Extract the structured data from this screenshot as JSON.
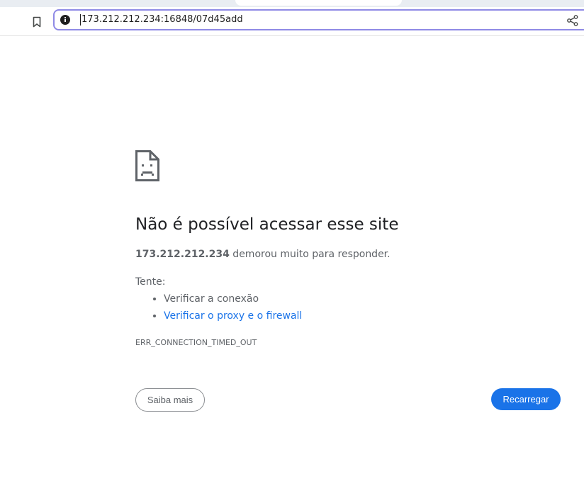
{
  "toolbar": {
    "bookmark_icon": "bookmark-icon",
    "site_info_icon": "info-icon",
    "url": "173.212.212.234:16848/07d45add",
    "share_icon": "share-icon"
  },
  "error_page": {
    "icon": "sad-page-icon",
    "title": "Não é possível acessar esse site",
    "summary_host": "173.212.212.234",
    "summary_text": " demorou muito para responder.",
    "suggestions_heading": "Tente:",
    "suggestions": [
      "Verificar a conexão",
      "Verificar o proxy e o firewall"
    ],
    "error_code": "ERR_CONNECTION_TIMED_OUT",
    "details_button": "Saiba mais",
    "reload_button": "Recarregar"
  },
  "colors": {
    "accent": "#1a73e8",
    "omnibox_border": "#8f8ae6",
    "text_secondary": "#5f6368",
    "text_primary": "#202124"
  }
}
